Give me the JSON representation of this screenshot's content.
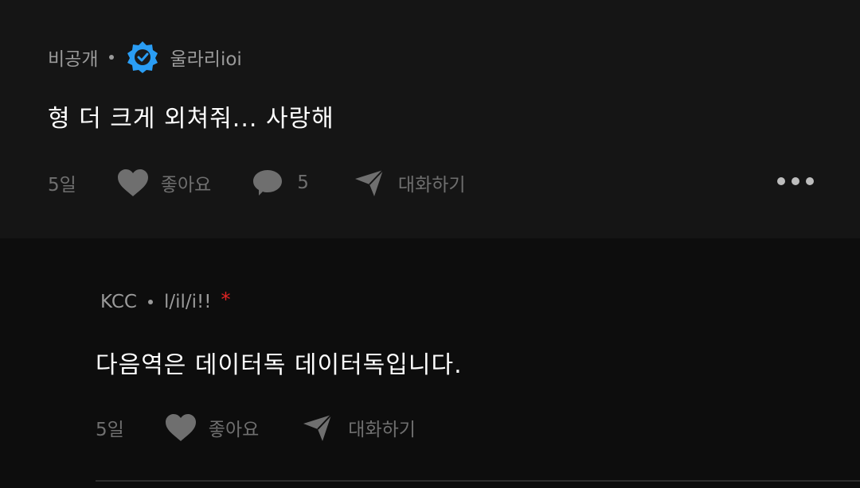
{
  "comment": {
    "visibility": "비공개",
    "author": "울라리ioi",
    "text": "형 더 크게 외쳐줘... 사랑해",
    "time": "5일",
    "like_label": "좋아요",
    "reply_count": "5",
    "chat_label": "대화하기"
  },
  "reply": {
    "group": "KCC",
    "author": "l/il/i!!",
    "star": "*",
    "text": "다음역은 데이터독 데이터독입니다.",
    "time": "5일",
    "like_label": "좋아요",
    "chat_label": "대화하기"
  },
  "colors": {
    "badge": "#2a9df4",
    "star": "#e02424",
    "icon": "#6f6f6f"
  }
}
